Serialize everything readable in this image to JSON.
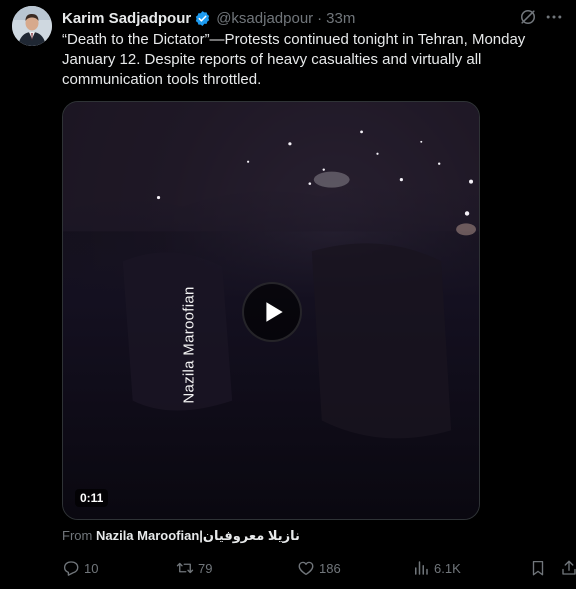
{
  "post": {
    "author_name": "Karim Sadjadpour",
    "handle": "@ksadjadpour",
    "separator": "·",
    "time": "33m",
    "text": "“Death to the Dictator”—Protests continued tonight in Tehran, Monday January 12. Despite reports of heavy casualties and virtually all communication tools throttled."
  },
  "media": {
    "watermark": "Nazila Maroofian",
    "duration": "0:11"
  },
  "source": {
    "prefix": "From",
    "name": "Nazila Maroofian|نازیلا معروفیان"
  },
  "actions": {
    "replies": "10",
    "reposts": "79",
    "likes": "186",
    "views": "6.1K"
  },
  "colors": {
    "background": "#000000",
    "text": "#e7e9ea",
    "muted": "#71767b",
    "verified": "#1d9bf0"
  }
}
